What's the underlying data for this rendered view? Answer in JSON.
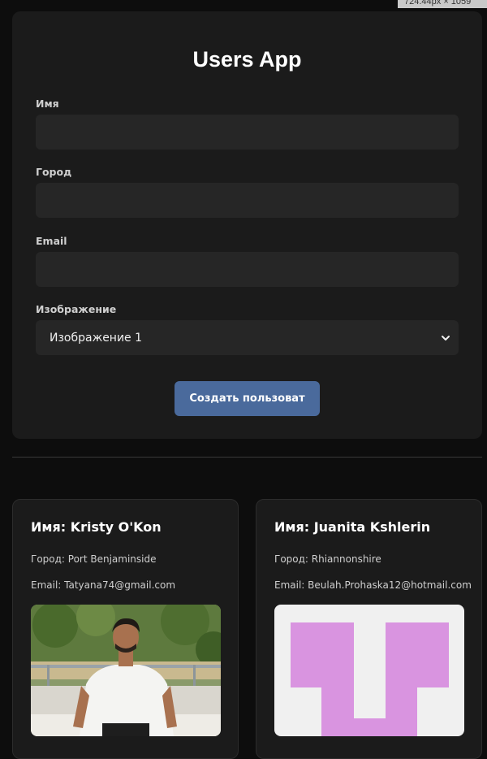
{
  "overlay": {
    "size_text": "724.44px × 1059"
  },
  "app": {
    "title": "Users App"
  },
  "form": {
    "name_label": "Имя",
    "name_value": "",
    "city_label": "Город",
    "city_value": "",
    "email_label": "Email",
    "email_value": "",
    "image_label": "Изображение",
    "image_selected": "Изображение 1",
    "submit_label": "Создать пользоват"
  },
  "users": [
    {
      "name": "Имя: Kristy O'Kon",
      "city": "Город: Port Benjaminside",
      "email": "Email: Tatyana74@gmail.com",
      "image": "photo-person"
    },
    {
      "name": "Имя: Juanita Kshlerin",
      "city": "Город: Rhiannonshire",
      "email": "Email: Beulah.Prohaska12@hotmail.com",
      "image": "pink-letter-graphic"
    }
  ],
  "colors": {
    "page_bg": "#0d0d0d",
    "card_bg": "#1b1b1b",
    "input_bg": "#262626",
    "button_bg": "#4a6a9c",
    "pink_graphic": "#d994e0"
  }
}
